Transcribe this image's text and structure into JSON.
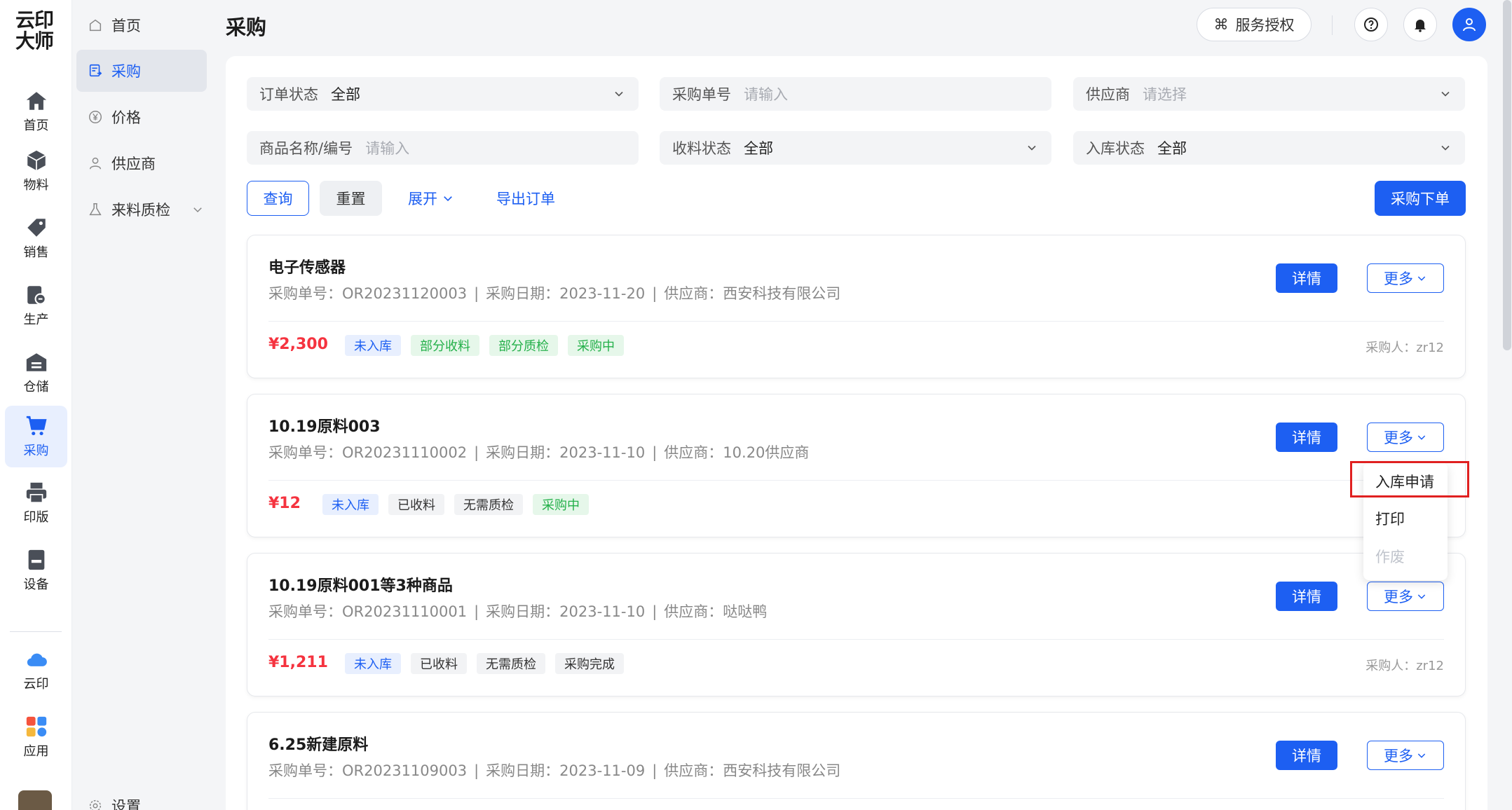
{
  "app": {
    "logo_line1": "云印",
    "logo_line2": "大师",
    "accent": "#1d5ff2"
  },
  "rail": {
    "items": [
      {
        "label": "首页",
        "icon": "home-icon"
      },
      {
        "label": "物料",
        "icon": "cube-icon"
      },
      {
        "label": "销售",
        "icon": "price-tag-icon"
      },
      {
        "label": "生产",
        "icon": "production-icon"
      },
      {
        "label": "仓储",
        "icon": "warehouse-icon"
      },
      {
        "label": "采购",
        "icon": "cart-icon",
        "active": true
      },
      {
        "label": "印版",
        "icon": "printer-icon"
      },
      {
        "label": "设备",
        "icon": "device-icon"
      },
      {
        "label": "云印",
        "icon": "cloud-icon"
      },
      {
        "label": "应用",
        "icon": "apps-icon"
      }
    ]
  },
  "subnav": {
    "items": [
      {
        "label": "首页",
        "icon": "home-outline-icon"
      },
      {
        "label": "采购",
        "icon": "purchase-doc-icon",
        "active": true
      },
      {
        "label": "价格",
        "icon": "yen-circle-icon"
      },
      {
        "label": "供应商",
        "icon": "person-icon"
      },
      {
        "label": "来料质检",
        "icon": "flask-icon",
        "expandable": true
      }
    ],
    "settings_label": "设置"
  },
  "header": {
    "title": "采购",
    "service_label": "服务授权"
  },
  "filters": {
    "order_status": {
      "label": "订单状态",
      "value": "全部"
    },
    "order_no": {
      "label": "采购单号",
      "placeholder": "请输入"
    },
    "supplier": {
      "label": "供应商",
      "placeholder": "请选择"
    },
    "product": {
      "label": "商品名称/编号",
      "placeholder": "请输入"
    },
    "receive_status": {
      "label": "收料状态",
      "value": "全部"
    },
    "stock_status": {
      "label": "入库状态",
      "value": "全部"
    }
  },
  "actions": {
    "query": "查询",
    "reset": "重置",
    "expand": "展开",
    "export": "导出订单",
    "place_order": "采购下单"
  },
  "orders": [
    {
      "title": "电子传感器",
      "order_no": "采购单号：OR20231120003",
      "date": "采购日期：2023-11-20",
      "supplier": "供应商：西安科技有限公司",
      "price": "¥2,300",
      "tags": [
        "未入库",
        "部分收料",
        "部分质检",
        "采购中"
      ],
      "buyer": "采购人：zr12"
    },
    {
      "title": "10.19原料003",
      "order_no": "采购单号：OR20231110002",
      "date": "采购日期：2023-11-10",
      "supplier": "供应商：10.20供应商",
      "price": "¥12",
      "tags": [
        "未入库",
        "已收料",
        "无需质检",
        "采购中"
      ],
      "buyer": ""
    },
    {
      "title": "10.19原料001等3种商品",
      "order_no": "采购单号：OR20231110001",
      "date": "采购日期：2023-11-10",
      "supplier": "供应商：哒哒鸭",
      "price": "¥1,211",
      "tags": [
        "未入库",
        "已收料",
        "无需质检",
        "采购完成"
      ],
      "buyer": "采购人：zr12"
    },
    {
      "title": "6.25新建原料",
      "order_no": "采购单号：OR20231109003",
      "date": "采购日期：2023-11-09",
      "supplier": "供应商：西安科技有限公司",
      "price": "",
      "tags": [],
      "buyer": ""
    }
  ],
  "card_buttons": {
    "detail": "详情",
    "more": "更多"
  },
  "more_menu": {
    "items": [
      "入库申请",
      "打印",
      "作废"
    ]
  }
}
